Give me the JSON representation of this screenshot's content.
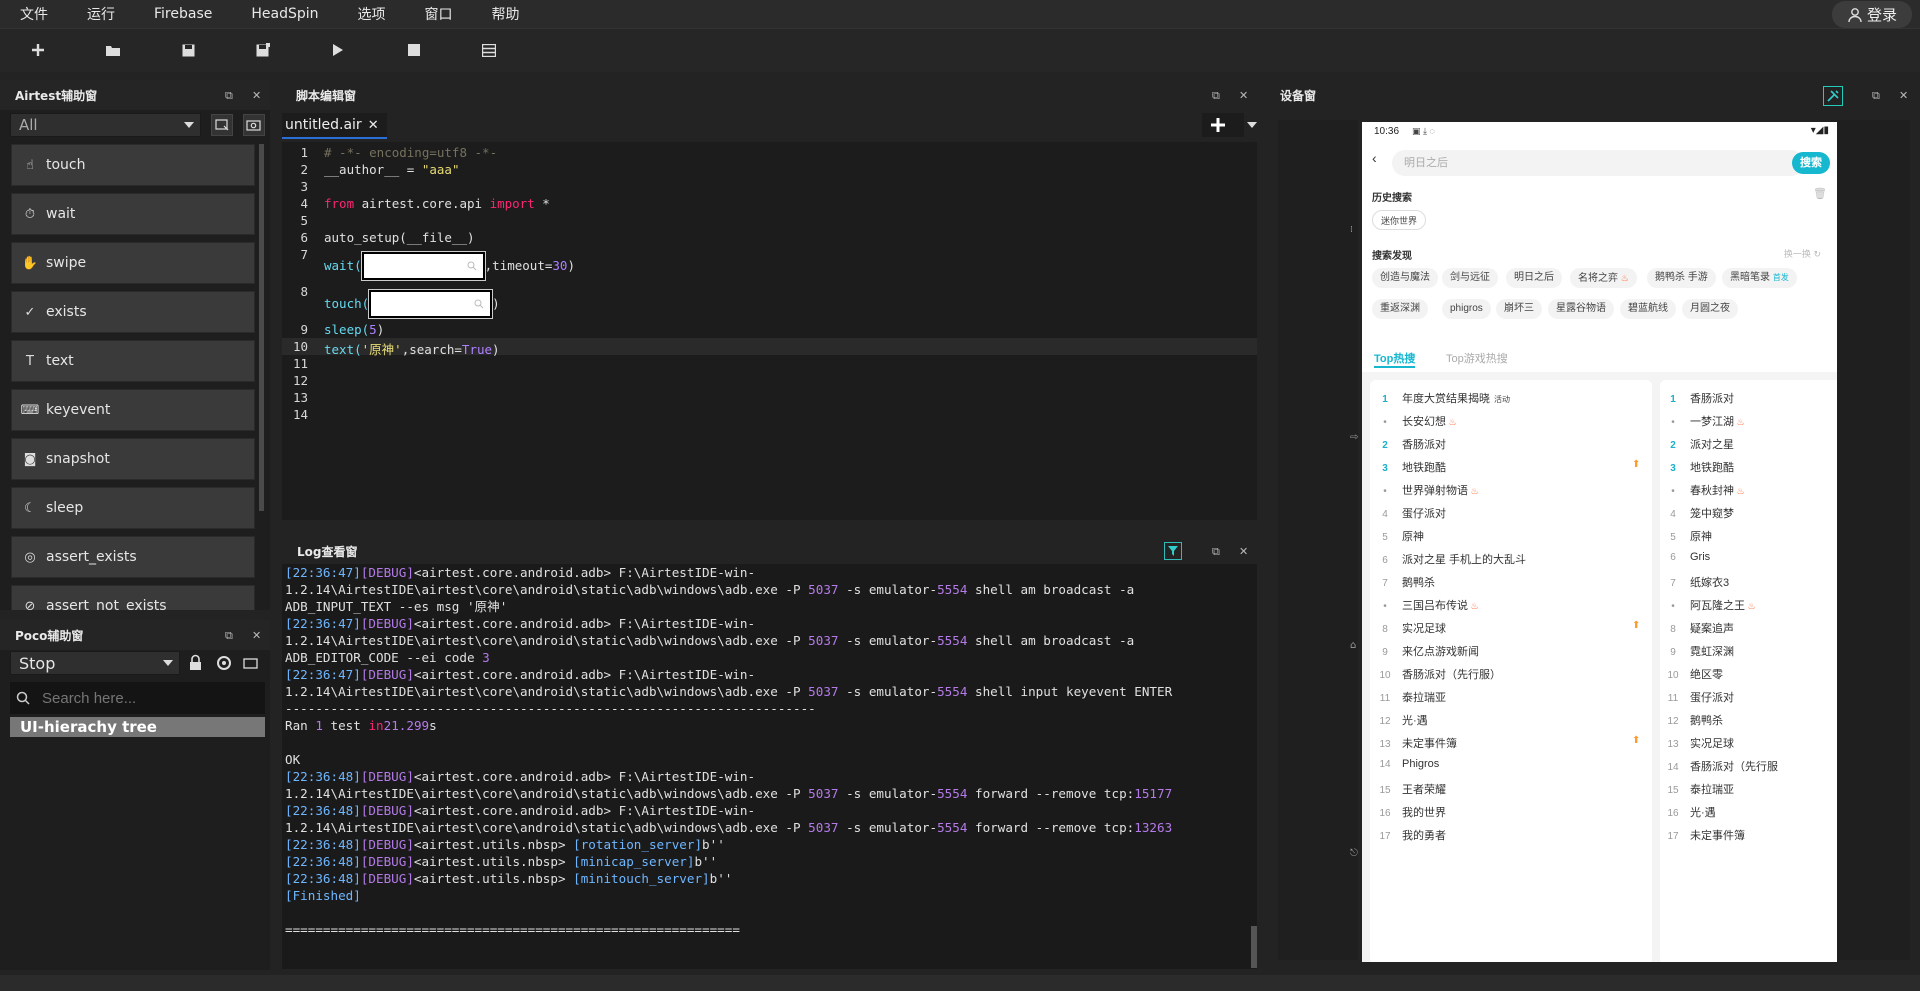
{
  "menu": {
    "items": [
      "文件",
      "运行",
      "Firebase",
      "HeadSpin",
      "选项",
      "窗口",
      "帮助"
    ],
    "login": "登录"
  },
  "airtest": {
    "title": "Airtest辅助窗",
    "filter": "All",
    "buttons": [
      "touch",
      "wait",
      "swipe",
      "exists",
      "text",
      "keyevent",
      "snapshot",
      "sleep",
      "assert_exists",
      "assert_not_exists"
    ]
  },
  "poco": {
    "title": "Poco辅助窗",
    "mode": "Stop",
    "search_placeholder": "Search here...",
    "tree_root": "UI-hierachy tree"
  },
  "editor": {
    "title": "脚本编辑窗",
    "tab": "untitled.air",
    "line_numbers": [
      "1",
      "2",
      "3",
      "4",
      "5",
      "6",
      "7",
      "8",
      "9",
      "10",
      "11",
      "12",
      "13",
      "14"
    ],
    "code": {
      "l1": "# -*- encoding=utf8 -*-",
      "l2a": "__author__ = ",
      "l2b": "\"aaa\"",
      "l4a": "from",
      "l4b": " airtest.core.api ",
      "l4c": "import",
      "l4d": " *",
      "l6": "auto_setup(__file__)",
      "l7a": "wait(",
      "l7b": ",timeout=",
      "l7c": "30",
      "l7d": ")",
      "l8a": "touch(",
      "l8b": ")",
      "l9a": "sleep(",
      "l9b": "5",
      "l9c": ")",
      "l10a": "text(",
      "l10b": "'原神'",
      "l10c": ",search=",
      "l10d": "True",
      "l10e": ")"
    }
  },
  "log": {
    "title": "Log查看窗",
    "lines": [
      {
        "ts": "[22:36:47]",
        "lvl": "[DEBUG]",
        "msg": "<airtest.core.android.adb> F:\\AirtestIDE-win-"
      },
      {
        "pre": "1.2.14\\AirtestIDE\\airtest\\core\\android\\static\\adb\\windows\\adb.exe -P ",
        "num": "5037",
        "post": " -s emulator-",
        "num2": "5554",
        "post2": " shell am broadcast -a"
      },
      {
        "plain": "ADB_INPUT_TEXT --es msg '原神'"
      },
      {
        "ts": "[22:36:47]",
        "lvl": "[DEBUG]",
        "msg": "<airtest.core.android.adb> F:\\AirtestIDE-win-"
      },
      {
        "pre": "1.2.14\\AirtestIDE\\airtest\\core\\android\\static\\adb\\windows\\adb.exe -P ",
        "num": "5037",
        "post": " -s emulator-",
        "num2": "5554",
        "post2": " shell am broadcast -a"
      },
      {
        "pre": "ADB_EDITOR_CODE --ei code ",
        "num": "3",
        "post": "",
        "num2": "",
        "post2": ""
      },
      {
        "ts": "[22:36:47]",
        "lvl": "[DEBUG]",
        "msg": "<airtest.core.android.adb> F:\\AirtestIDE-win-"
      },
      {
        "pre": "1.2.14\\AirtestIDE\\airtest\\core\\android\\static\\adb\\windows\\adb.exe -P ",
        "num": "5037",
        "post": " -s emulator-",
        "num2": "5554",
        "post2": " shell input keyevent ENTER"
      },
      {
        "plain": "----------------------------------------------------------------------"
      },
      {
        "pre": "Ran ",
        "num": "1",
        "post": " test ",
        "kw": "in",
        "num2": "21.299",
        "post2": "s"
      },
      {
        "plain": ""
      },
      {
        "plain": "OK"
      },
      {
        "ts": "[22:36:48]",
        "lvl": "[DEBUG]",
        "msg": "<airtest.core.android.adb> F:\\AirtestIDE-win-"
      },
      {
        "pre": "1.2.14\\AirtestIDE\\airtest\\core\\android\\static\\adb\\windows\\adb.exe -P ",
        "num": "5037",
        "post": " -s emulator-",
        "num2": "5554",
        "post2": " forward --remove tcp:",
        "num3": "15177"
      },
      {
        "ts": "[22:36:48]",
        "lvl": "[DEBUG]",
        "msg": "<airtest.core.android.adb> F:\\AirtestIDE-win-"
      },
      {
        "pre": "1.2.14\\AirtestIDE\\airtest\\core\\android\\static\\adb\\windows\\adb.exe -P ",
        "num": "5037",
        "post": " -s emulator-",
        "num2": "5554",
        "post2": " forward --remove tcp:",
        "num3": "13263"
      },
      {
        "ts": "[22:36:48]",
        "lvl": "[DEBUG]",
        "msg": "<airtest.utils.nbsp> ",
        "hl": "[rotation_server]",
        "tail": "b''"
      },
      {
        "ts": "[22:36:48]",
        "lvl": "[DEBUG]",
        "msg": "<airtest.utils.nbsp> ",
        "hl": "[minicap_server]",
        "tail": "b''"
      },
      {
        "ts": "[22:36:48]",
        "lvl": "[DEBUG]",
        "msg": "<airtest.utils.nbsp> ",
        "hl": "[minitouch_server]",
        "tail": "b''"
      },
      {
        "hlonly": "[Finished]"
      },
      {
        "plain": ""
      },
      {
        "plain": "============================================================"
      }
    ]
  },
  "device": {
    "title": "设备窗",
    "phone": {
      "time": "10:36",
      "search_placeholder": "明日之后",
      "search_btn": "搜索",
      "history_title": "历史搜索",
      "history_chip": "迷你世界",
      "discover_title": "搜索发现",
      "refresh": "换一换",
      "discover_row1": [
        "创造与魔法",
        "剑与远征",
        "明日之后",
        "名将之弈",
        "鹅鸭杀 手游",
        "黑暗笔录"
      ],
      "discover_row2": [
        "重返深渊",
        "phigros",
        "崩坏三",
        "星露谷物语",
        "碧蓝航线",
        "月圆之夜"
      ],
      "tab_active": "Top热搜",
      "tab_other": "Top游戏热搜",
      "activity_badge": "活动",
      "first_badge": "首发",
      "left_list": [
        {
          "n": "1",
          "t": "年度大赏结果揭晓"
        },
        {
          "n": "•",
          "t": "长安幻想"
        },
        {
          "n": "2",
          "t": "香肠派对"
        },
        {
          "n": "3",
          "t": "地铁跑酷"
        },
        {
          "n": "•",
          "t": "世界弹射物语"
        },
        {
          "n": "4",
          "t": "蛋仔派对"
        },
        {
          "n": "5",
          "t": "原神"
        },
        {
          "n": "6",
          "t": "派对之星 手机上的大乱斗"
        },
        {
          "n": "7",
          "t": "鹅鸭杀"
        },
        {
          "n": "•",
          "t": "三国吕布传说"
        },
        {
          "n": "8",
          "t": "实况足球"
        },
        {
          "n": "9",
          "t": "来亿点游戏新闻"
        },
        {
          "n": "10",
          "t": "香肠派对（先行服）"
        },
        {
          "n": "11",
          "t": "泰拉瑞亚"
        },
        {
          "n": "12",
          "t": "光·遇"
        },
        {
          "n": "13",
          "t": "未定事件簿"
        },
        {
          "n": "14",
          "t": "Phigros"
        },
        {
          "n": "15",
          "t": "王者荣耀"
        },
        {
          "n": "16",
          "t": "我的世界"
        },
        {
          "n": "17",
          "t": "我的勇者"
        }
      ],
      "right_list": [
        {
          "n": "1",
          "t": "香肠派对"
        },
        {
          "n": "•",
          "t": "一梦江湖"
        },
        {
          "n": "2",
          "t": "派对之星"
        },
        {
          "n": "3",
          "t": "地铁跑酷"
        },
        {
          "n": "•",
          "t": "春秋封神"
        },
        {
          "n": "4",
          "t": "笼中窥梦"
        },
        {
          "n": "5",
          "t": "原神"
        },
        {
          "n": "6",
          "t": "Gris"
        },
        {
          "n": "7",
          "t": "纸嫁衣3"
        },
        {
          "n": "•",
          "t": "阿瓦隆之王"
        },
        {
          "n": "8",
          "t": "疑案追声"
        },
        {
          "n": "9",
          "t": "霓虹深渊"
        },
        {
          "n": "10",
          "t": "绝区零"
        },
        {
          "n": "11",
          "t": "蛋仔派对"
        },
        {
          "n": "12",
          "t": "鹅鸭杀"
        },
        {
          "n": "13",
          "t": "实况足球"
        },
        {
          "n": "14",
          "t": "香肠派对（先行服"
        },
        {
          "n": "15",
          "t": "泰拉瑞亚"
        },
        {
          "n": "16",
          "t": "光·遇"
        },
        {
          "n": "17",
          "t": "未定事件簿"
        }
      ]
    }
  }
}
